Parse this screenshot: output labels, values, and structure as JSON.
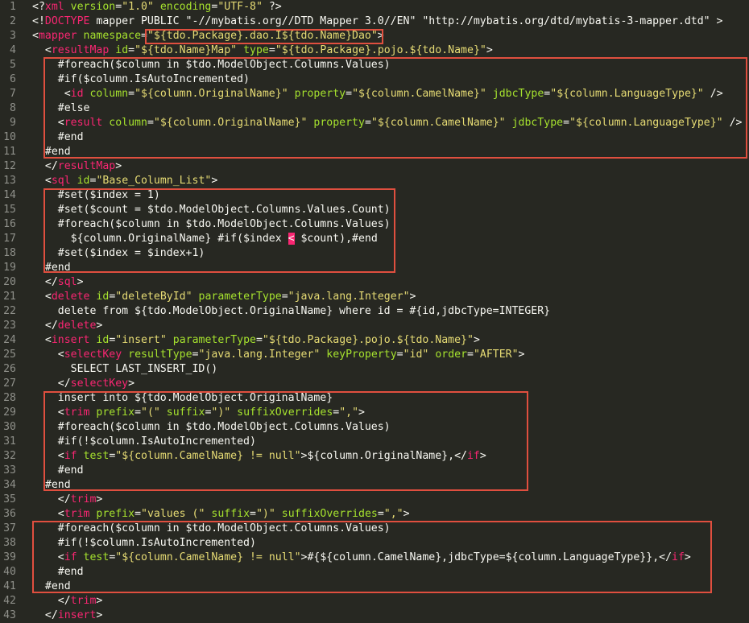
{
  "editor": {
    "lines": [
      {
        "n": "1",
        "tokens": [
          [
            "plain",
            "<?"
          ],
          [
            "tag",
            "xml"
          ],
          [
            "plain",
            " "
          ],
          [
            "attr",
            "version"
          ],
          [
            "plain",
            "="
          ],
          [
            "str",
            "\"1.0\""
          ],
          [
            "plain",
            " "
          ],
          [
            "attr",
            "encoding"
          ],
          [
            "plain",
            "="
          ],
          [
            "str",
            "\"UTF-8\""
          ],
          [
            "plain",
            " ?>"
          ]
        ]
      },
      {
        "n": "2",
        "tokens": [
          [
            "plain",
            "<!"
          ],
          [
            "tag",
            "DOCTYPE"
          ],
          [
            "plain",
            " mapper PUBLIC \"-//mybatis.org//DTD Mapper 3.0//EN\" \"http://mybatis.org/dtd/mybatis-3-mapper.dtd\" >"
          ]
        ]
      },
      {
        "n": "3",
        "tokens": [
          [
            "plain",
            "<"
          ],
          [
            "tag",
            "mapper"
          ],
          [
            "plain",
            " "
          ],
          [
            "attr",
            "namespace"
          ],
          [
            "plain",
            "="
          ],
          [
            "str",
            "\"${tdo.Package}.dao.I${tdo.Name}Dao\""
          ],
          [
            "plain",
            ">"
          ]
        ]
      },
      {
        "n": "4",
        "tokens": [
          [
            "plain",
            "  <"
          ],
          [
            "tag",
            "resultMap"
          ],
          [
            "plain",
            " "
          ],
          [
            "attr",
            "id"
          ],
          [
            "plain",
            "="
          ],
          [
            "str",
            "\"${tdo.Name}Map\""
          ],
          [
            "plain",
            " "
          ],
          [
            "attr",
            "type"
          ],
          [
            "plain",
            "="
          ],
          [
            "str",
            "\"${tdo.Package}.pojo.${tdo.Name}\""
          ],
          [
            "plain",
            ">"
          ]
        ]
      },
      {
        "n": "5",
        "tokens": [
          [
            "plain",
            "    #foreach($column in $tdo.ModelObject.Columns.Values)"
          ]
        ]
      },
      {
        "n": "6",
        "tokens": [
          [
            "plain",
            "    #if($column.IsAutoIncremented)"
          ]
        ]
      },
      {
        "n": "7",
        "tokens": [
          [
            "plain",
            "     <"
          ],
          [
            "tag",
            "id"
          ],
          [
            "plain",
            " "
          ],
          [
            "attr",
            "column"
          ],
          [
            "plain",
            "="
          ],
          [
            "str",
            "\"${column.OriginalName}\""
          ],
          [
            "plain",
            " "
          ],
          [
            "attr",
            "property"
          ],
          [
            "plain",
            "="
          ],
          [
            "str",
            "\"${column.CamelName}\""
          ],
          [
            "plain",
            " "
          ],
          [
            "attr",
            "jdbcType"
          ],
          [
            "plain",
            "="
          ],
          [
            "str",
            "\"${column.LanguageType}\""
          ],
          [
            "plain",
            " />"
          ]
        ]
      },
      {
        "n": "8",
        "tokens": [
          [
            "plain",
            "    #else"
          ]
        ]
      },
      {
        "n": "9",
        "tokens": [
          [
            "plain",
            "    <"
          ],
          [
            "tag",
            "result"
          ],
          [
            "plain",
            " "
          ],
          [
            "attr",
            "column"
          ],
          [
            "plain",
            "="
          ],
          [
            "str",
            "\"${column.OriginalName}\""
          ],
          [
            "plain",
            " "
          ],
          [
            "attr",
            "property"
          ],
          [
            "plain",
            "="
          ],
          [
            "str",
            "\"${column.CamelName}\""
          ],
          [
            "plain",
            " "
          ],
          [
            "attr",
            "jdbcType"
          ],
          [
            "plain",
            "="
          ],
          [
            "str",
            "\"${column.LanguageType}\""
          ],
          [
            "plain",
            " />"
          ]
        ]
      },
      {
        "n": "10",
        "tokens": [
          [
            "plain",
            "    #end"
          ]
        ]
      },
      {
        "n": "11",
        "tokens": [
          [
            "plain",
            "  #end"
          ]
        ]
      },
      {
        "n": "12",
        "tokens": [
          [
            "plain",
            "  </"
          ],
          [
            "tag",
            "resultMap"
          ],
          [
            "plain",
            ">"
          ]
        ]
      },
      {
        "n": "13",
        "tokens": [
          [
            "plain",
            "  <"
          ],
          [
            "tag",
            "sql"
          ],
          [
            "plain",
            " "
          ],
          [
            "attr",
            "id"
          ],
          [
            "plain",
            "="
          ],
          [
            "str",
            "\"Base_Column_List\""
          ],
          [
            "plain",
            ">"
          ]
        ]
      },
      {
        "n": "14",
        "tokens": [
          [
            "plain",
            "    #set($index = 1)"
          ]
        ]
      },
      {
        "n": "15",
        "tokens": [
          [
            "plain",
            "    #set($count = $tdo.ModelObject.Columns.Values.Count)"
          ]
        ]
      },
      {
        "n": "16",
        "tokens": [
          [
            "plain",
            "    #foreach($column in $tdo.ModelObject.Columns.Values)"
          ]
        ]
      },
      {
        "n": "17",
        "tokens": [
          [
            "plain",
            "      ${column.OriginalName} #if($index "
          ],
          [
            "sel",
            "<"
          ],
          [
            "plain",
            " $count),#end"
          ]
        ]
      },
      {
        "n": "18",
        "tokens": [
          [
            "plain",
            "    #set($index = $index+1)"
          ]
        ]
      },
      {
        "n": "19",
        "tokens": [
          [
            "plain",
            "  #end"
          ]
        ]
      },
      {
        "n": "20",
        "tokens": [
          [
            "plain",
            "  </"
          ],
          [
            "tag",
            "sql"
          ],
          [
            "plain",
            ">"
          ]
        ]
      },
      {
        "n": "21",
        "tokens": [
          [
            "plain",
            "  <"
          ],
          [
            "tag",
            "delete"
          ],
          [
            "plain",
            " "
          ],
          [
            "attr",
            "id"
          ],
          [
            "plain",
            "="
          ],
          [
            "str",
            "\"deleteById\""
          ],
          [
            "plain",
            " "
          ],
          [
            "attr",
            "parameterType"
          ],
          [
            "plain",
            "="
          ],
          [
            "str",
            "\"java.lang.Integer\""
          ],
          [
            "plain",
            ">"
          ]
        ]
      },
      {
        "n": "22",
        "tokens": [
          [
            "plain",
            "    delete from ${tdo.ModelObject.OriginalName} where id = #{id,jdbcType=INTEGER}"
          ]
        ]
      },
      {
        "n": "23",
        "tokens": [
          [
            "plain",
            "  </"
          ],
          [
            "tag",
            "delete"
          ],
          [
            "plain",
            ">"
          ]
        ]
      },
      {
        "n": "24",
        "tokens": [
          [
            "plain",
            "  <"
          ],
          [
            "tag",
            "insert"
          ],
          [
            "plain",
            " "
          ],
          [
            "attr",
            "id"
          ],
          [
            "plain",
            "="
          ],
          [
            "str",
            "\"insert\""
          ],
          [
            "plain",
            " "
          ],
          [
            "attr",
            "parameterType"
          ],
          [
            "plain",
            "="
          ],
          [
            "str",
            "\"${tdo.Package}.pojo.${tdo.Name}\""
          ],
          [
            "plain",
            ">"
          ]
        ]
      },
      {
        "n": "25",
        "tokens": [
          [
            "plain",
            "    <"
          ],
          [
            "tag",
            "selectKey"
          ],
          [
            "plain",
            " "
          ],
          [
            "attr",
            "resultType"
          ],
          [
            "plain",
            "="
          ],
          [
            "str",
            "\"java.lang.Integer\""
          ],
          [
            "plain",
            " "
          ],
          [
            "attr",
            "keyProperty"
          ],
          [
            "plain",
            "="
          ],
          [
            "str",
            "\"id\""
          ],
          [
            "plain",
            " "
          ],
          [
            "attr",
            "order"
          ],
          [
            "plain",
            "="
          ],
          [
            "str",
            "\"AFTER\""
          ],
          [
            "plain",
            ">"
          ]
        ]
      },
      {
        "n": "26",
        "tokens": [
          [
            "plain",
            "      SELECT LAST_INSERT_ID()"
          ]
        ]
      },
      {
        "n": "27",
        "tokens": [
          [
            "plain",
            "    </"
          ],
          [
            "tag",
            "selectKey"
          ],
          [
            "plain",
            ">"
          ]
        ]
      },
      {
        "n": "28",
        "tokens": [
          [
            "plain",
            "    insert into ${tdo.ModelObject.OriginalName}"
          ]
        ]
      },
      {
        "n": "29",
        "tokens": [
          [
            "plain",
            "    <"
          ],
          [
            "tag",
            "trim"
          ],
          [
            "plain",
            " "
          ],
          [
            "attr",
            "prefix"
          ],
          [
            "plain",
            "="
          ],
          [
            "str",
            "\"(\""
          ],
          [
            "plain",
            " "
          ],
          [
            "attr",
            "suffix"
          ],
          [
            "plain",
            "="
          ],
          [
            "str",
            "\")\""
          ],
          [
            "plain",
            " "
          ],
          [
            "attr",
            "suffixOverrides"
          ],
          [
            "plain",
            "="
          ],
          [
            "str",
            "\",\""
          ],
          [
            "plain",
            ">"
          ]
        ]
      },
      {
        "n": "30",
        "tokens": [
          [
            "plain",
            "    #foreach($column in $tdo.ModelObject.Columns.Values)"
          ]
        ]
      },
      {
        "n": "31",
        "tokens": [
          [
            "plain",
            "    #if(!$column.IsAutoIncremented)"
          ]
        ]
      },
      {
        "n": "32",
        "tokens": [
          [
            "plain",
            "    <"
          ],
          [
            "tag",
            "if"
          ],
          [
            "plain",
            " "
          ],
          [
            "attr",
            "test"
          ],
          [
            "plain",
            "="
          ],
          [
            "str",
            "\"${column.CamelName} != null\""
          ],
          [
            "plain",
            ">${column.OriginalName},</"
          ],
          [
            "tag",
            "if"
          ],
          [
            "plain",
            ">"
          ]
        ]
      },
      {
        "n": "33",
        "tokens": [
          [
            "plain",
            "    #end"
          ]
        ]
      },
      {
        "n": "34",
        "tokens": [
          [
            "plain",
            "  #end"
          ]
        ]
      },
      {
        "n": "35",
        "tokens": [
          [
            "plain",
            "    </"
          ],
          [
            "tag",
            "trim"
          ],
          [
            "plain",
            ">"
          ]
        ]
      },
      {
        "n": "36",
        "tokens": [
          [
            "plain",
            "    <"
          ],
          [
            "tag",
            "trim"
          ],
          [
            "plain",
            " "
          ],
          [
            "attr",
            "prefix"
          ],
          [
            "plain",
            "="
          ],
          [
            "str",
            "\"values (\""
          ],
          [
            "plain",
            " "
          ],
          [
            "attr",
            "suffix"
          ],
          [
            "plain",
            "="
          ],
          [
            "str",
            "\")\""
          ],
          [
            "plain",
            " "
          ],
          [
            "attr",
            "suffixOverrides"
          ],
          [
            "plain",
            "="
          ],
          [
            "str",
            "\",\""
          ],
          [
            "plain",
            ">"
          ]
        ]
      },
      {
        "n": "37",
        "tokens": [
          [
            "plain",
            "    #foreach($column in $tdo.ModelObject.Columns.Values)"
          ]
        ]
      },
      {
        "n": "38",
        "tokens": [
          [
            "plain",
            "    #if(!$column.IsAutoIncremented)"
          ]
        ]
      },
      {
        "n": "39",
        "tokens": [
          [
            "plain",
            "    <"
          ],
          [
            "tag",
            "if"
          ],
          [
            "plain",
            " "
          ],
          [
            "attr",
            "test"
          ],
          [
            "plain",
            "="
          ],
          [
            "str",
            "\"${column.CamelName} != null\""
          ],
          [
            "plain",
            ">#{${column.CamelName},jdbcType=${column.LanguageType}},</"
          ],
          [
            "tag",
            "if"
          ],
          [
            "plain",
            ">"
          ]
        ]
      },
      {
        "n": "40",
        "tokens": [
          [
            "plain",
            "    #end"
          ]
        ]
      },
      {
        "n": "41",
        "tokens": [
          [
            "plain",
            "  #end"
          ]
        ]
      },
      {
        "n": "42",
        "tokens": [
          [
            "plain",
            "    </"
          ],
          [
            "tag",
            "trim"
          ],
          [
            "plain",
            ">"
          ]
        ]
      },
      {
        "n": "43",
        "tokens": [
          [
            "plain",
            "  </"
          ],
          [
            "tag",
            "insert"
          ],
          [
            "plain",
            ">"
          ]
        ]
      }
    ]
  }
}
